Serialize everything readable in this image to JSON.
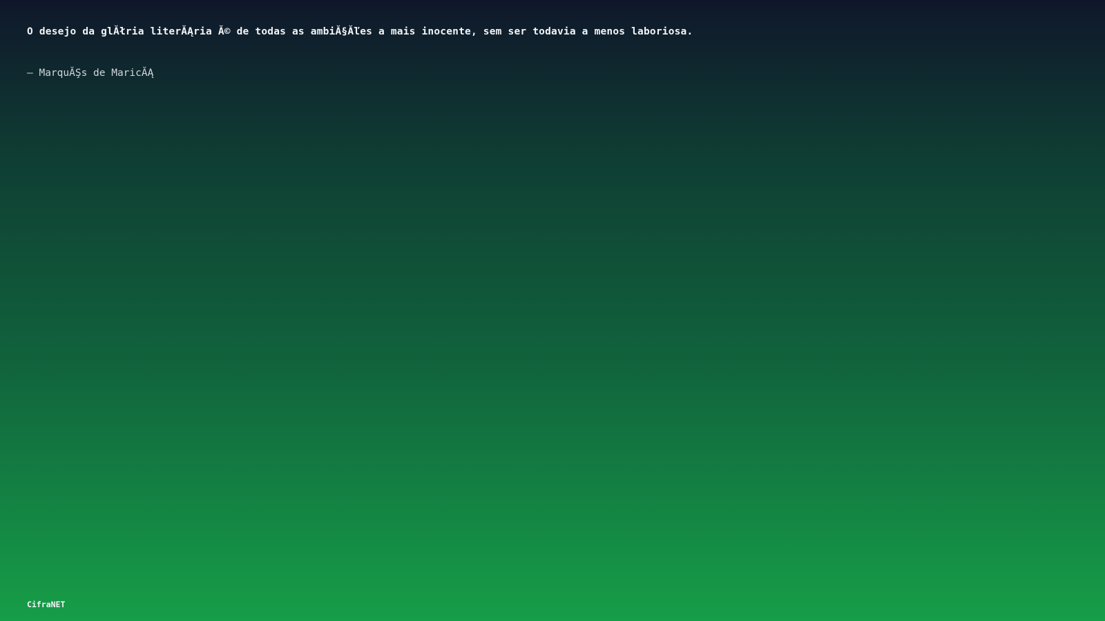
{
  "quote": {
    "text": "O desejo da glĂłria literĂĄria Ă© de todas as ambiĂ§Ăľes a mais inocente, sem ser todavia a menos laboriosa.",
    "author": "– MarquĂŞs de MaricĂĄ"
  },
  "footer": {
    "brand": "CifraNET"
  },
  "theme": {
    "gradient_top": "#0f172a",
    "gradient_bottom": "#169e48"
  }
}
